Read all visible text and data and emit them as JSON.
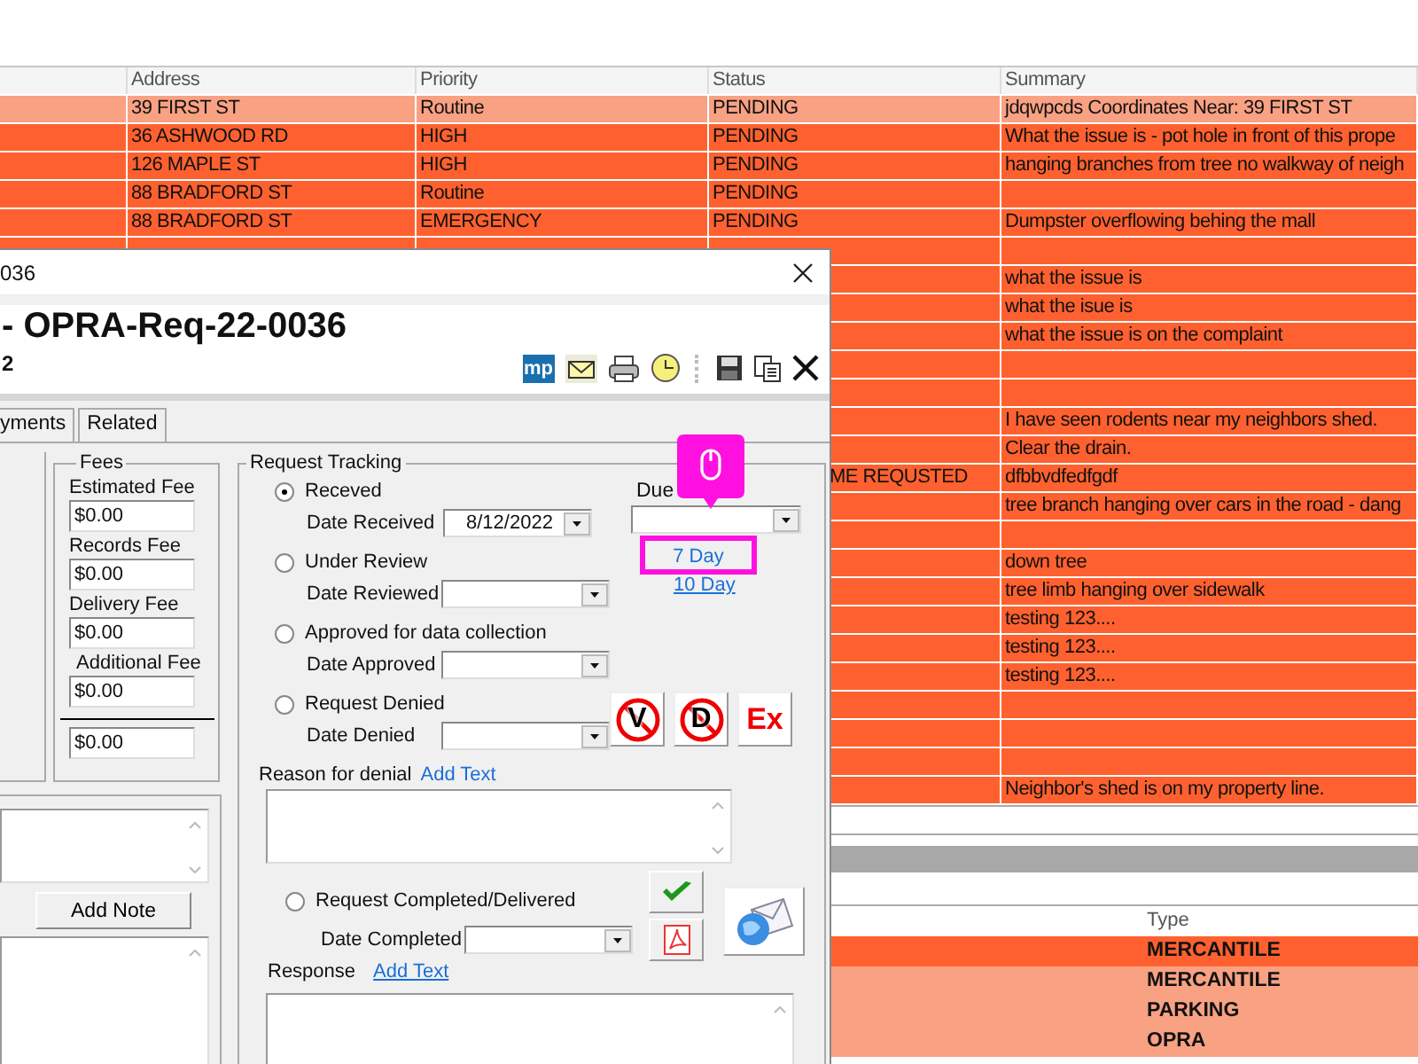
{
  "top_grid": {
    "columns": [
      "Address",
      "Priority",
      "Status",
      "Summary"
    ],
    "rows": [
      {
        "color": "#f9a183",
        "address": "39 FIRST ST",
        "priority": "Routine",
        "status": "PENDING",
        "summary": "jdqwpcds Coordinates Near: 39 FIRST ST"
      },
      {
        "color": "#fe612f",
        "address": "36 ASHWOOD RD",
        "priority": "HIGH",
        "status": "PENDING",
        "summary": "What the issue is - pot hole in front of this prope"
      },
      {
        "color": "#fe612f",
        "address": "126 MAPLE ST",
        "priority": "HIGH",
        "status": "PENDING",
        "summary": "hanging branches from tree no walkway of neigh"
      },
      {
        "color": "#fe612f",
        "address": "88 BRADFORD ST",
        "priority": "Routine",
        "status": "PENDING"
      },
      {
        "color": "#fe612f",
        "address": "88 BRADFORD ST",
        "priority": "EMERGENCY",
        "status": "PENDING",
        "summary": "Dumpster overflowing behing the mall"
      },
      {
        "color": "#fe612f"
      },
      {
        "color": "#fe612f",
        "summary": "what the issue is"
      },
      {
        "color": "#fe612f",
        "summary": "what the isue is"
      },
      {
        "color": "#fe612f",
        "summary": "what the issue is on the complaint"
      },
      {
        "color": "#fe612f"
      },
      {
        "color": "#fe612f"
      },
      {
        "color": "#fe612f",
        "summary": "I have seen rodents near my neighbors shed."
      },
      {
        "color": "#fe612f",
        "summary": "Clear the drain."
      },
      {
        "color": "#fe612f",
        "status_tail": "ME REQUSTED",
        "summary": "dfbbvdfedfgdf"
      },
      {
        "color": "#fe612f",
        "summary": "tree branch hanging over cars in the road - dang"
      },
      {
        "color": "#fe612f"
      },
      {
        "color": "#fe612f",
        "summary": "down tree"
      },
      {
        "color": "#fe612f",
        "summary": "tree limb hanging over sidewalk"
      },
      {
        "color": "#fe612f",
        "summary": "testing 123...."
      },
      {
        "color": "#fe612f",
        "summary": "testing 123...."
      },
      {
        "color": "#fe612f",
        "summary": "testing 123...."
      },
      {
        "color": "#fe612f"
      },
      {
        "color": "#fe612f"
      },
      {
        "color": "#fe612f"
      },
      {
        "color": "#fe612f",
        "summary": "Neighbor's shed is on my property line."
      }
    ]
  },
  "dialog": {
    "title": "036",
    "heading": "- OPRA-Req-22-0036",
    "subheading": "2",
    "toolbar": [
      {
        "kind": "mp",
        "label": "mp"
      },
      {
        "kind": "mail"
      },
      {
        "kind": "print"
      },
      {
        "kind": "clock"
      },
      {
        "kind": "save"
      },
      {
        "kind": "copy"
      },
      {
        "kind": "delete"
      }
    ],
    "tabs": [
      {
        "label": "yments",
        "selected": false
      },
      {
        "label": "Related",
        "selected": false
      }
    ],
    "fees": {
      "title": "Fees",
      "items": [
        {
          "label": "Estimated Fee",
          "value": "$0.00"
        },
        {
          "label": "Records Fee",
          "value": "$0.00"
        },
        {
          "label": "Delivery Fee",
          "value": "$0.00"
        },
        {
          "label": "Additional Fee",
          "value": "$0.00"
        }
      ],
      "total": "$0.00"
    },
    "notes": {
      "button": "Add Note"
    },
    "tracking": {
      "title": "Request Tracking",
      "steps": [
        {
          "label": "Receved",
          "selected": true,
          "date_label": "Date Received",
          "date": "8/12/2022"
        },
        {
          "label": "Under Review",
          "selected": false,
          "date_label": "Date Reviewed"
        },
        {
          "label": "Approved for data collection",
          "selected": false,
          "date_label": "Date Approved"
        },
        {
          "label": "Request Denied",
          "selected": false,
          "date_label": "Date Denied"
        }
      ],
      "due": {
        "label": "Due",
        "links": [
          {
            "label": "7 Day",
            "highlighted": true
          },
          {
            "label": "10 Day",
            "highlighted": false
          }
        ]
      },
      "denial_buttons": [
        {
          "kind": "prohibit",
          "label": "V"
        },
        {
          "kind": "prohibit",
          "label": "D"
        },
        {
          "kind": "text",
          "label": "Ex"
        }
      ],
      "reason": {
        "label": "Reason for denial",
        "link": "Add Text"
      },
      "completed": {
        "label": "Request Completed/Delivered",
        "selected": false,
        "date_label": "Date Completed"
      },
      "response": {
        "label": "Response",
        "link": "Add Text"
      }
    }
  },
  "bottom_grid": {
    "columns": [
      "Type"
    ],
    "rows": [
      {
        "color": "#fe612f",
        "type": "MERCANTILE"
      },
      {
        "color": "#f9a183",
        "type": "MERCANTILE"
      },
      {
        "color": "#f9a183",
        "type": "PARKING"
      },
      {
        "color": "#f9a183",
        "type": "OPRA"
      }
    ]
  }
}
